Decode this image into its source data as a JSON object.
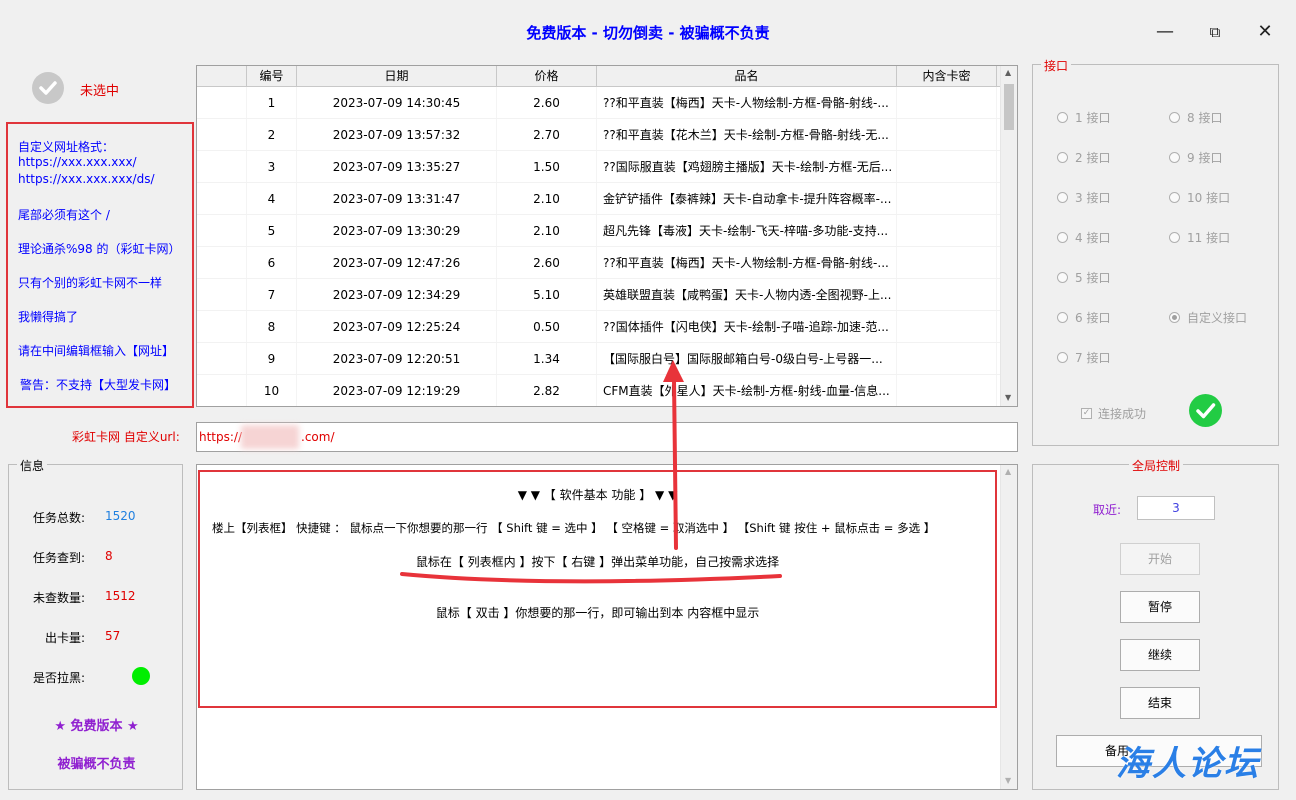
{
  "window": {
    "title": "免费版本 - 切勿倒卖 - 被骗概不负责",
    "minimize": "—",
    "maximize": "⧉",
    "close": "✕"
  },
  "selection": {
    "status": "未选中"
  },
  "notice": [
    "自定义网址格式：",
    "https://xxx.xxx.xxx/",
    "https://xxx.xxx.xxx/ds/",
    "尾部必须有这个 /",
    "理论通杀%98 的（彩虹卡网）",
    "只有个别的彩虹卡网不一样",
    "我懒得搞了",
    "请在中间编辑框输入【网址】",
    "警告：不支持【大型发卡网】"
  ],
  "table": {
    "headers": [
      "",
      "编号",
      "日期",
      "价格",
      "品名",
      "内含卡密"
    ],
    "rows": [
      [
        "1",
        "2023-07-09 14:30:45",
        "2.60",
        "??和平直装【梅西】天卡-人物绘制-方框-骨骼-射线-..."
      ],
      [
        "2",
        "2023-07-09 13:57:32",
        "2.70",
        "??和平直装【花木兰】天卡-绘制-方框-骨骼-射线-无..."
      ],
      [
        "3",
        "2023-07-09 13:35:27",
        "1.50",
        "??国际服直装【鸡翅膀主播版】天卡-绘制-方框-无后..."
      ],
      [
        "4",
        "2023-07-09 13:31:47",
        "2.10",
        "金铲铲插件【泰裤辣】天卡-自动拿卡-提升阵容概率-..."
      ],
      [
        "5",
        "2023-07-09 13:30:29",
        "2.10",
        "超凡先锋【毒液】天卡-绘制-飞天-梓喵-多功能-支持..."
      ],
      [
        "6",
        "2023-07-09 12:47:26",
        "2.60",
        "??和平直装【梅西】天卡-人物绘制-方框-骨骼-射线-..."
      ],
      [
        "7",
        "2023-07-09 12:34:29",
        "5.10",
        "英雄联盟直装【咸鸭蛋】天卡-人物内透-全图视野-上..."
      ],
      [
        "8",
        "2023-07-09 12:25:24",
        "0.50",
        "??国体插件【闪电侠】天卡-绘制-子喵-追踪-加速-范..."
      ],
      [
        "9",
        "2023-07-09 12:20:51",
        "1.34",
        "【国际服白号】国际服邮箱白号-0级白号-上号器一..."
      ],
      [
        "10",
        "2023-07-09 12:19:29",
        "2.82",
        "CFM直装【外星人】天卡-绘制-方框-射线-血量-信息..."
      ]
    ]
  },
  "url": {
    "label": "彩虹卡网 自定义url:",
    "prefix": "https://",
    "suffix": ".com/"
  },
  "info": {
    "title": "信息",
    "total_label": "任务总数:",
    "total": "1520",
    "found_label": "任务查到:",
    "found": "8",
    "unchecked_label": "未查数量:",
    "unchecked": "1512",
    "cards_label": "出卡量:",
    "cards": "57",
    "blacklist_label": "是否拉黑:",
    "free_label": "★ 免费版本 ★",
    "warn_label": "被骗概不负责"
  },
  "help": {
    "title": "▼ ▼ 【 软件基本 功能 】 ▼ ▼",
    "line1": "楼上【列表框】 快捷键 ： 鼠标点一下你想要的那一行 【 Shift 键 = 选中 】     【 空格键 = 取消选中 】     【Shift 键 按住 + 鼠标点击 = 多选 】",
    "line2": "鼠标在【 列表框内 】按下【 右键 】弹出菜单功能，自己按需求选择",
    "line3": "鼠标【 双击 】你想要的那一行，即可输出到本 内容框中显示"
  },
  "interface": {
    "title": "接口",
    "left": [
      "1  接口",
      "2  接口",
      "3  接口",
      "4  接口",
      "5  接口",
      "6  接口",
      "7  接口"
    ],
    "right": [
      "8  接口",
      "9  接口",
      "10  接口",
      "11  接口",
      "自定义接口"
    ],
    "connected_label": "连接成功"
  },
  "control": {
    "title": "全局控制",
    "recent_label": "取近:",
    "recent_value": "3",
    "start": "开始",
    "pause": "暂停",
    "resume": "继续",
    "end": "结束",
    "backup": "备用"
  },
  "watermark": "海人论坛",
  "colors": {
    "accent_blue": "#0000ff",
    "warn_red": "#e00000",
    "box_red": "#e0353b",
    "green": "#22cc44"
  }
}
